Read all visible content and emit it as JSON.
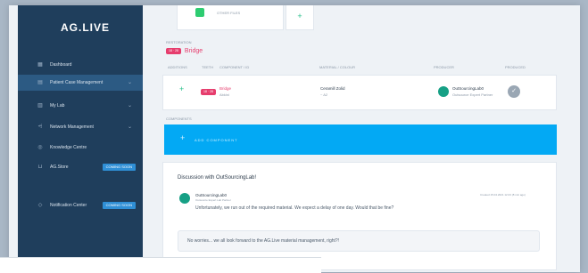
{
  "sidebar": {
    "logo": "AG.LIVE",
    "items": [
      {
        "label": "Dashboard",
        "icon": "grid-icon"
      },
      {
        "label": "Patient Case Management",
        "icon": "document-icon",
        "chevron": true
      },
      {
        "label": "My Lab",
        "icon": "lab-icon",
        "chevron": true
      },
      {
        "label": "Network Management",
        "icon": "network-icon",
        "chevron": true
      },
      {
        "label": "Knowledge Centre",
        "icon": "help-icon"
      },
      {
        "label": "AG.Store",
        "icon": "cart-icon",
        "badge": "COMING SOON"
      },
      {
        "label": "Notification Center",
        "icon": "bell-icon",
        "badge": "COMING SOON"
      }
    ]
  },
  "top": {
    "other_files_label": "OTHER FILES"
  },
  "restoration": {
    "section_label": "RESTORATION",
    "pill": "18 · 28",
    "title": "Bridge",
    "columns": [
      "ADDITIONS",
      "TEETH",
      "COMPONENT / ID",
      "MATERIAL / COLOUR",
      "PRODUCER",
      "PRODUCED"
    ],
    "row": {
      "pill": "18 · 28",
      "component": "Bridge",
      "component_sub": "Abkini",
      "material": "Ceramill Zolid",
      "material_sub": "~ A2",
      "producer": "OutSourcingLab0",
      "producer_sub": "Outsource Expert Partner"
    }
  },
  "components": {
    "section_label": "COMPONENTS",
    "add_label": "ADD COMPONENT"
  },
  "discussion": {
    "title": "Discussion with OutSourcingLab!",
    "message_author": "OutSourcingLab0",
    "message_role": "Outsource Expert Lab Partner",
    "message_time": "Created 15.04.2021 12:23 (8 min ago)",
    "message_text": "Unfortunately, we run out of the required material. We expect a delay of one day. Would that be fine?",
    "reply_text": "No worries... we all look forward to the AG.Live material management, right?!"
  },
  "colors": {
    "sidebar": "#1f3e5c",
    "accent_blue": "#03a9f4",
    "pill_red": "#e63d6d",
    "green": "#27c08a"
  }
}
